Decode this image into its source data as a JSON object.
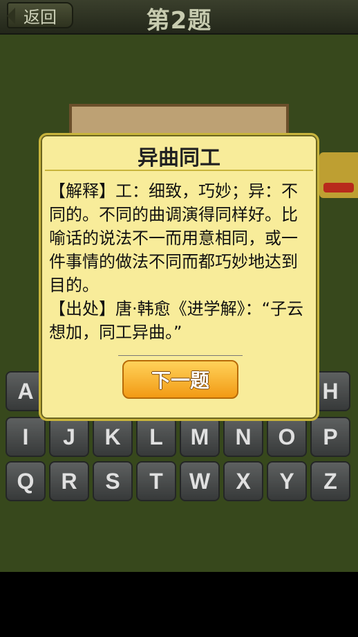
{
  "header": {
    "back_label": "返回",
    "title": "第2题"
  },
  "keyboard": {
    "rows": [
      [
        "A",
        "",
        "",
        "",
        "",
        "",
        "",
        "H"
      ],
      [
        "I",
        "J",
        "K",
        "L",
        "M",
        "N",
        "O",
        "P"
      ],
      [
        "Q",
        "R",
        "S",
        "T",
        "W",
        "X",
        "Y",
        "Z"
      ]
    ]
  },
  "dialog": {
    "title": "异曲同工",
    "explanation": "【解释】工：细致，巧妙；异：不同的。不同的曲调演得同样好。比喻话的说法不一而用意相同，或一件事情的做法不同而都巧妙地达到目的。",
    "source": "【出处】唐·韩愈《进学解》：“子云想加，同工异曲。”",
    "next_label": "下一题"
  },
  "colors": {
    "game_bg": "#3f5320",
    "dialog_bg": "#f8ec9a",
    "next_button": "#f5a623"
  }
}
